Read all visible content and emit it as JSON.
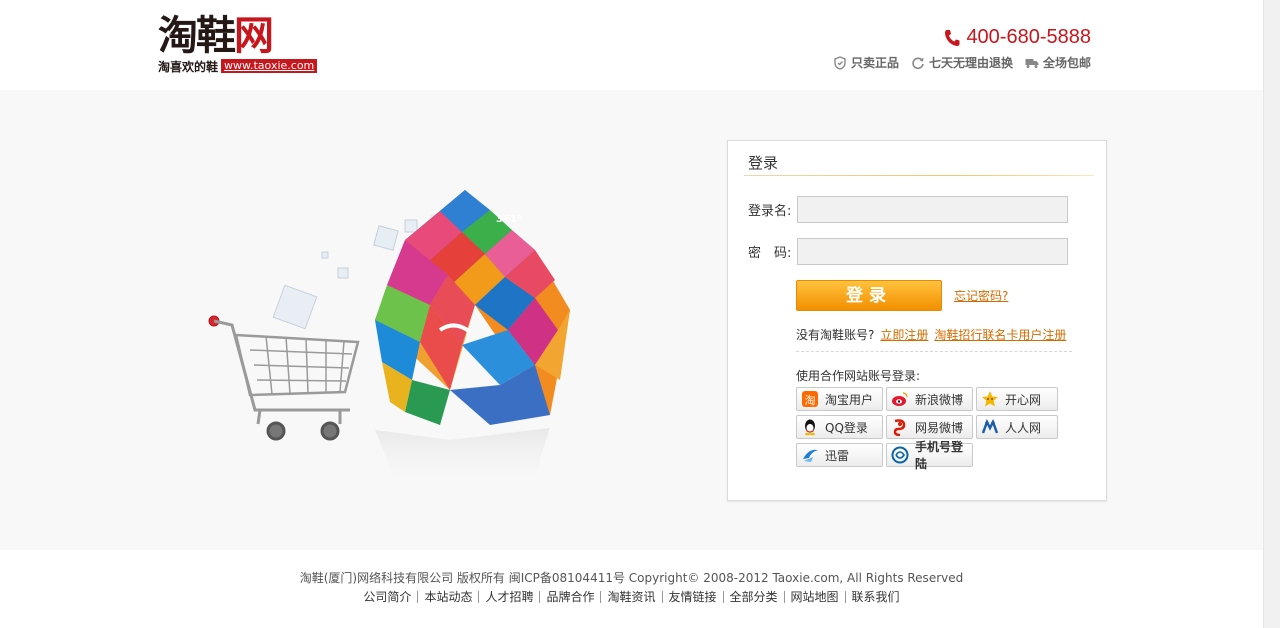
{
  "header": {
    "logo_text_1": "淘",
    "logo_text_2": "鞋",
    "logo_text_3": "网",
    "logo_slogan": "淘喜欢的鞋",
    "logo_url": "www.taoxie.com",
    "phone": "400-680-5888",
    "promises": [
      {
        "label": "只卖正品",
        "icon": "shield-icon"
      },
      {
        "label": "七天无理由退换",
        "icon": "refresh-icon"
      },
      {
        "label": "全场包邮",
        "icon": "truck-icon"
      }
    ]
  },
  "login": {
    "title": "登录",
    "username_label": "登录名:",
    "password_label": "密　码:",
    "username_value": "",
    "password_value": "",
    "submit_label": "登录",
    "forgot_link": "忘记密码?",
    "no_account_text": "没有淘鞋账号?",
    "register_link": "立即注册",
    "cmb_register_link": "淘鞋招行联名卡用户注册",
    "partner_title": "使用合作网站账号登录:",
    "partners": [
      {
        "label": "淘宝用户",
        "icon": "taobao-icon",
        "color": "#ff6a00"
      },
      {
        "label": "新浪微博",
        "icon": "weibo-icon",
        "color": "#e6162d"
      },
      {
        "label": "开心网",
        "icon": "kaixin-icon",
        "color": "#f5b800"
      },
      {
        "label": "QQ登录",
        "icon": "qq-icon",
        "color": "#000000"
      },
      {
        "label": "网易微博",
        "icon": "netease-weibo-icon",
        "color": "#d81e06"
      },
      {
        "label": "人人网",
        "icon": "renren-icon",
        "color": "#1c5fa8"
      },
      {
        "label": "迅雷",
        "icon": "xunlei-icon",
        "color": "#1a7fd4"
      },
      {
        "label": "手机号登陆",
        "icon": "china-mobile-icon",
        "color": "#0a62a8"
      }
    ]
  },
  "footer": {
    "copyright": "淘鞋(厦门)网络科技有限公司 版权所有 闽ICP备08104411号 Copyright© 2008-2012 Taoxie.com, All Rights Reserved",
    "links": [
      "公司简介",
      "本站动态",
      "人才招聘",
      "品牌合作",
      "淘鞋资讯",
      "友情链接",
      "全部分类",
      "网站地图",
      "联系我们"
    ]
  },
  "colors": {
    "brand_red": "#c8161d",
    "link_orange": "#d36b00",
    "button_orange": "#f28f00"
  }
}
